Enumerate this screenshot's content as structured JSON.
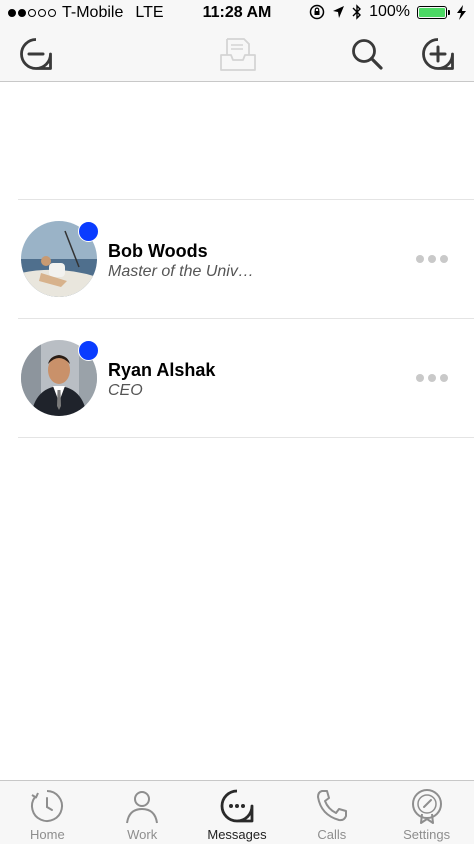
{
  "status_bar": {
    "carrier": "T-Mobile",
    "network": "LTE",
    "time": "11:28 AM",
    "battery": "100%",
    "battery_level": 1.0
  },
  "toolbar": {
    "left_icon": "minus-bubble-icon",
    "center_icon": "inbox-tray-icon",
    "search_icon": "search-icon",
    "add_icon": "plus-bubble-icon"
  },
  "contacts": [
    {
      "name": "Bob Woods",
      "title": "Master of the Univ…",
      "unread": true
    },
    {
      "name": "Ryan Alshak",
      "title": "CEO",
      "unread": true
    }
  ],
  "tabs": [
    {
      "label": "Home",
      "icon": "clock-icon",
      "active": false
    },
    {
      "label": "Work",
      "icon": "person-icon",
      "active": false
    },
    {
      "label": "Messages",
      "icon": "chat-bubble-icon",
      "active": true
    },
    {
      "label": "Calls",
      "icon": "phone-icon",
      "active": false
    },
    {
      "label": "Settings",
      "icon": "settings-badge-icon",
      "active": false
    }
  ],
  "colors": {
    "unread_badge": "#0a3cff",
    "battery_fill": "#4cd964",
    "bar_background": "#f7f7f7"
  }
}
